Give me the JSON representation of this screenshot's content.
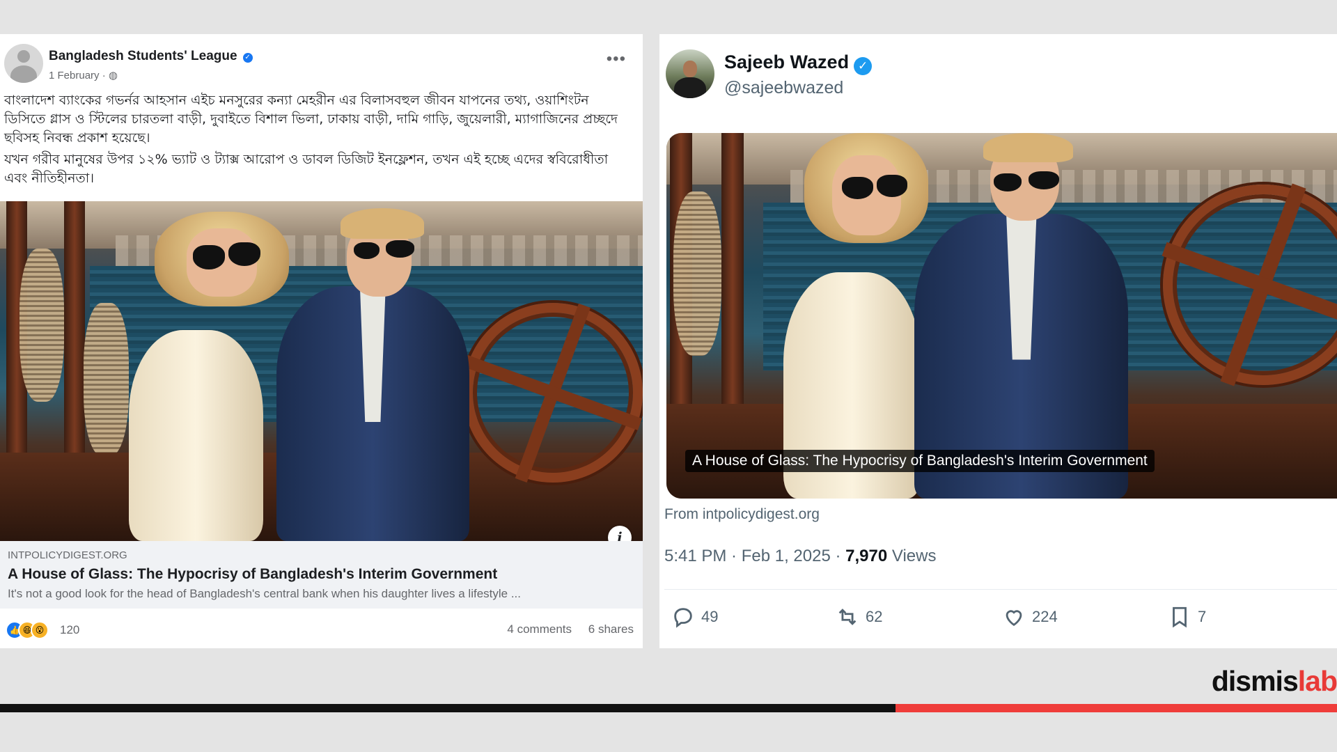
{
  "facebook_post": {
    "page_name": "Bangladesh Students' League",
    "verified_icon": "verified-badge-icon",
    "date": "1 February",
    "visibility_icon": "globe-icon",
    "more_icon": "more-options-icon",
    "caption_paragraph_1": "বাংলাদেশ ব্যাংকের গভর্নর আহসান এইচ মনসুরের কন্যা মেহরীন এর বিলাসবহুল জীবন যাপনের তথ্য, ওয়াশিংটন ডিসিতে গ্লাস ও স্টিলের চারতলা বাড়ী, দুবাইতে বিশাল ভিলা, ঢাকায় বাড়ী, দামি গাড়ি, জুয়েলারী, ম্যাগাজিনের প্রচ্ছদে ছবিসহ নিবন্ধ প্রকাশ হয়েছে।",
    "caption_paragraph_2": "যখন গরীব মানুষের উপর ১২% ভ্যাট ও ট্যাক্স আরোপ ও ডাবল ডিজিট ইনফ্লেশন, তখন এই হচ্ছে এদের স্ববিরোধীতা এবং নীতিহীনতা।",
    "link_domain": "INTPOLICYDIGEST.ORG",
    "link_title": "A House of Glass: The Hypocrisy of Bangladesh's Interim Government",
    "link_description": "It's not a good look for the head of Bangladesh's central bank when his daughter lives a lifestyle ...",
    "info_label": "i",
    "reaction_count": "120",
    "comments": "4 comments",
    "shares": "6 shares"
  },
  "tweet": {
    "display_name": "Sajeeb Wazed",
    "handle": "@sajeebwazed",
    "image_title": "A House of Glass: The Hypocrisy of Bangladesh's Interim Government",
    "source": "From intpolicydigest.org",
    "time_date": "5:41 PM · Feb 1, 2025 · ",
    "views_count": "7,970",
    "views_label": " Views",
    "replies": "49",
    "retweets": "62",
    "likes": "224",
    "bookmarks": "7"
  },
  "brand": {
    "name_part_1": "dismis",
    "name_part_2": "lab"
  },
  "progress": {
    "played_fraction": 0.67
  },
  "colors": {
    "facebook_blue": "#1877f2",
    "twitter_blue": "#1d9bf0",
    "progress_red": "#ef3d3a"
  }
}
